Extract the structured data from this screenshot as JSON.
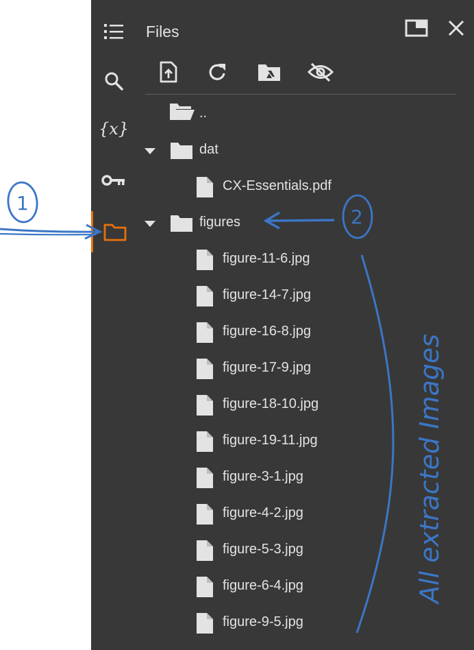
{
  "panel": {
    "title": "Files",
    "rail": [
      {
        "name": "table-of-contents-icon"
      },
      {
        "name": "search-icon"
      },
      {
        "name": "variables-icon"
      },
      {
        "name": "secrets-key-icon"
      },
      {
        "name": "folder-icon",
        "active": true
      }
    ],
    "variables_glyph": "{x}",
    "toolbar": [
      "upload-file-icon",
      "refresh-icon",
      "mount-drive-icon",
      "hide-hidden-files-icon"
    ]
  },
  "tree": {
    "parent_label": "..",
    "items": [
      {
        "label": "dat",
        "type": "folder",
        "expanded": true,
        "depth": 0
      },
      {
        "label": "CX-Essentials.pdf",
        "type": "file",
        "depth": 1
      },
      {
        "label": "figures",
        "type": "folder",
        "expanded": true,
        "depth": 0
      },
      {
        "label": "figure-11-6.jpg",
        "type": "file",
        "depth": 1
      },
      {
        "label": "figure-14-7.jpg",
        "type": "file",
        "depth": 1
      },
      {
        "label": "figure-16-8.jpg",
        "type": "file",
        "depth": 1
      },
      {
        "label": "figure-17-9.jpg",
        "type": "file",
        "depth": 1
      },
      {
        "label": "figure-18-10.jpg",
        "type": "file",
        "depth": 1
      },
      {
        "label": "figure-19-11.jpg",
        "type": "file",
        "depth": 1
      },
      {
        "label": "figure-3-1.jpg",
        "type": "file",
        "depth": 1
      },
      {
        "label": "figure-4-2.jpg",
        "type": "file",
        "depth": 1
      },
      {
        "label": "figure-5-3.jpg",
        "type": "file",
        "depth": 1
      },
      {
        "label": "figure-6-4.jpg",
        "type": "file",
        "depth": 1
      },
      {
        "label": "figure-9-5.jpg",
        "type": "file",
        "depth": 1
      }
    ]
  },
  "annotations": {
    "marker_1": "1",
    "marker_2": "2",
    "vertical_note": "All extracted Images"
  },
  "colors": {
    "panel_bg": "#383838",
    "text": "#e3e3e3",
    "accent": "#e8710a",
    "annotation": "#3c76c6"
  }
}
